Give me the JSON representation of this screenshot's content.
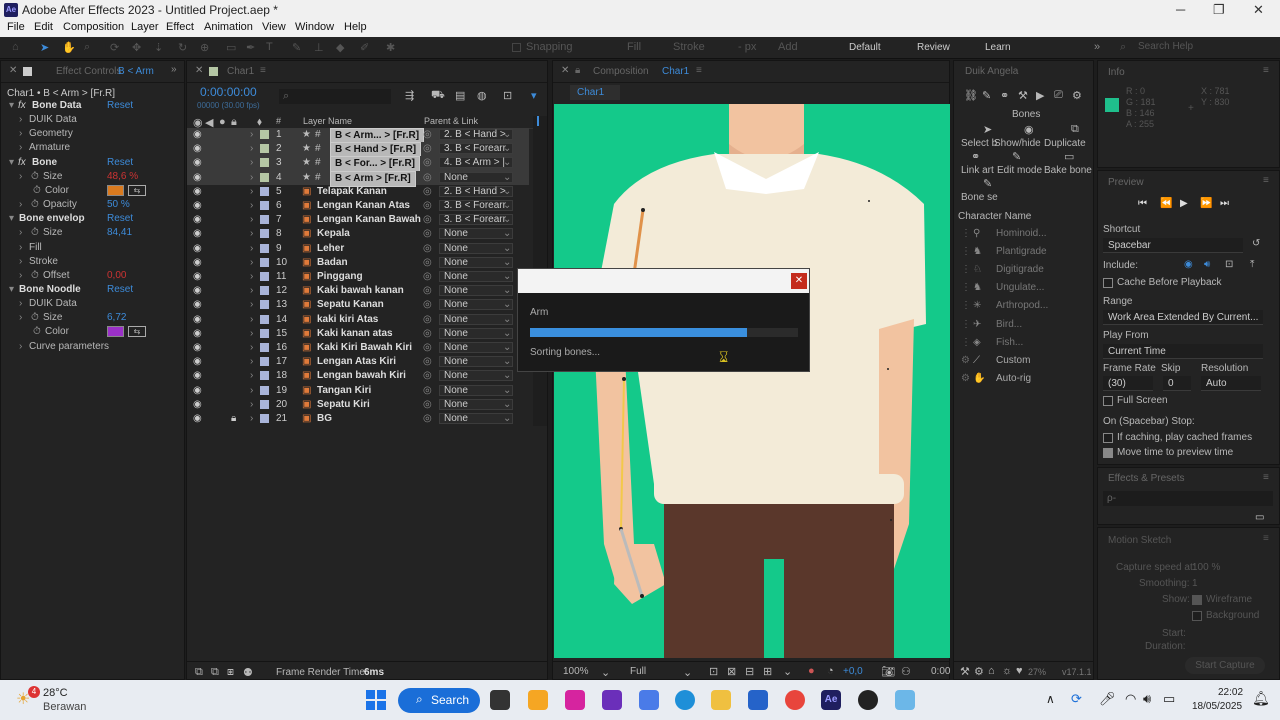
{
  "window": {
    "title": "Adobe After Effects 2023 - Untitled Project.aep *",
    "app_icon": "Ae"
  },
  "menu": [
    "File",
    "Edit",
    "Composition",
    "Layer",
    "Effect",
    "Animation",
    "View",
    "Window",
    "Help"
  ],
  "toolbar": {
    "snapping": "Snapping",
    "fill": "Fill",
    "stroke": "Stroke",
    "px": "- px",
    "add": "Add",
    "workspaces": [
      "Default",
      "Review",
      "Learn"
    ],
    "search_placeholder": "Search Help"
  },
  "effect_controls": {
    "tab": "Effect Controls",
    "tab_target": "B < Arm",
    "header": "Char1 • B < Arm > [Fr.R]",
    "rows": [
      {
        "label": "Bone Data",
        "value": "Reset",
        "fx": true
      },
      {
        "label": "DUIK Data"
      },
      {
        "label": "Geometry"
      },
      {
        "label": "Armature"
      },
      {
        "label": "Bone",
        "value": "Reset",
        "fx": true
      },
      {
        "label": "Size",
        "value": "48,6",
        "unit": "%"
      },
      {
        "label": "Color"
      },
      {
        "label": "Opacity",
        "value": "50",
        "unit": "%"
      },
      {
        "label": "Bone envelop",
        "value": "Reset"
      },
      {
        "label": "Size",
        "value": "84,41"
      },
      {
        "label": "Fill"
      },
      {
        "label": "Stroke"
      },
      {
        "label": "Offset",
        "value": "0,00"
      },
      {
        "label": "Bone Noodle",
        "value": "Reset"
      },
      {
        "label": "DUIK Data"
      },
      {
        "label": "Size",
        "value": "6,72"
      },
      {
        "label": "Color"
      },
      {
        "label": "Curve parameters"
      }
    ],
    "colors": {
      "bone_color": "#d97a1f",
      "noodle_color": "#9b30c8"
    }
  },
  "timeline": {
    "tab": "Char1",
    "timecode": "0:00:00:00",
    "fps": "00000 (30.00 fps)",
    "col_layer": "Layer Name",
    "col_parent": "Parent & Link",
    "col_num": "#",
    "frame_render_label": "Frame Render Time:",
    "frame_render_value": "6ms",
    "layers": [
      {
        "n": "1",
        "name": "B < Arm... > [Fr.R]",
        "parent": "2. B < Hand >"
      },
      {
        "n": "2",
        "name": "B < Hand > [Fr.R]",
        "parent": "3. B < Forearr"
      },
      {
        "n": "3",
        "name": "B < For... > [Fr.R]",
        "parent": "4. B < Arm > |"
      },
      {
        "n": "4",
        "name": "B < Arm > [Fr.R]",
        "parent": "None"
      },
      {
        "n": "5",
        "name": "Telapak Kanan",
        "parent": "2. B < Hand >"
      },
      {
        "n": "6",
        "name": "Lengan Kanan Atas",
        "parent": "3. B < Forearr"
      },
      {
        "n": "7",
        "name": "Lengan Kanan Bawah",
        "parent": "3. B < Forearr"
      },
      {
        "n": "8",
        "name": "Kepala",
        "parent": "None"
      },
      {
        "n": "9",
        "name": "Leher",
        "parent": "None"
      },
      {
        "n": "10",
        "name": "Badan",
        "parent": "None"
      },
      {
        "n": "11",
        "name": "Pinggang",
        "parent": "None"
      },
      {
        "n": "12",
        "name": "Kaki bawah kanan",
        "parent": "None"
      },
      {
        "n": "13",
        "name": "Sepatu Kanan",
        "parent": "None"
      },
      {
        "n": "14",
        "name": "kaki kiri Atas",
        "parent": "None"
      },
      {
        "n": "15",
        "name": "Kaki kanan atas",
        "parent": "None"
      },
      {
        "n": "16",
        "name": "Kaki Kiri Bawah Kiri",
        "parent": "None"
      },
      {
        "n": "17",
        "name": "Lengan Atas Kiri",
        "parent": "None"
      },
      {
        "n": "18",
        "name": "Lengan bawah Kiri",
        "parent": "None"
      },
      {
        "n": "19",
        "name": "Tangan Kiri",
        "parent": "None"
      },
      {
        "n": "20",
        "name": "Sepatu Kiri",
        "parent": "None"
      },
      {
        "n": "21",
        "name": "BG",
        "parent": "None"
      }
    ]
  },
  "composition": {
    "tab": "Composition",
    "tab_target": "Char1",
    "chip": "Char1",
    "zoom": "100%",
    "quality": "Full",
    "exposure": "+0,0",
    "time": "0:00",
    "bg_color": "#14c98a"
  },
  "dialog": {
    "title": "Arm",
    "status": "Sorting bones...",
    "progress": 0.81
  },
  "duik": {
    "tab": "Duik Angela",
    "bones_label": "Bones",
    "actions": [
      "Select b",
      "Show/hide",
      "Duplicate",
      "Link art",
      "Edit mode",
      "Bake bone",
      "Bone se"
    ],
    "char_label": "Character Name",
    "characters": [
      "Hominoid...",
      "Plantigrade",
      "Digitigrade",
      "Ungulate...",
      "Arthropod...",
      "Bird...",
      "Fish...",
      "Custom",
      "Auto-rig"
    ],
    "footer_pct": "27%",
    "version": "v17.1.1"
  },
  "info": {
    "tab": "Info",
    "r": "R : 0",
    "g": "G : 181",
    "b": "B : 146",
    "a": "A : 255",
    "x": "X : 781",
    "y": "Y : 830",
    "swatch": "#1fbf8c"
  },
  "preview": {
    "tab": "Preview",
    "shortcut_label": "Shortcut",
    "shortcut": "Spacebar",
    "include_label": "Include:",
    "cache_before": "Cache Before Playback",
    "range_label": "Range",
    "range": "Work Area Extended By Current...",
    "play_from_label": "Play From",
    "play_from": "Current Time",
    "fr_label": "Frame Rate",
    "skip_label": "Skip",
    "res_label": "Resolution",
    "fr": "(30)",
    "skip": "0",
    "res": "Auto",
    "full_screen": "Full Screen",
    "stop_label": "On (Spacebar) Stop:",
    "if_caching": "If caching, play cached frames",
    "move_time": "Move time to preview time"
  },
  "effects_presets": {
    "tab": "Effects & Presets",
    "search": "ρ-"
  },
  "motion_sketch": {
    "tab": "Motion Sketch",
    "speed_label": "Capture speed at:",
    "speed": "100 %",
    "smoothing_label": "Smoothing:",
    "smoothing": "1",
    "show_label": "Show:",
    "wireframe": "Wireframe",
    "background": "Background",
    "start_label": "Start:",
    "duration_label": "Duration:",
    "start_btn": "Start Capture"
  },
  "taskbar": {
    "weather_temp": "28°C",
    "weather_desc": "Berawan",
    "search": "Search",
    "time": "22:02",
    "date": "18/05/2025",
    "badge": "4"
  }
}
